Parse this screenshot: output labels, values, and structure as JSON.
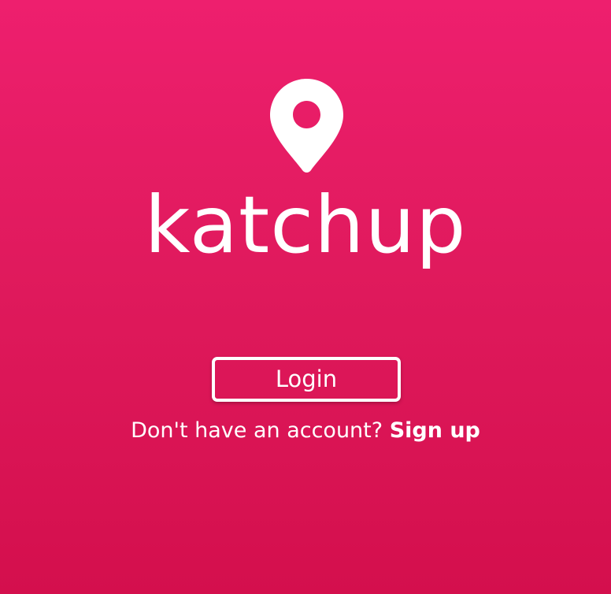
{
  "theme": {
    "background_top": "#ee1f6e",
    "background_bottom": "#d40f4d",
    "foreground": "#ffffff"
  },
  "logo": {
    "icon": "map-pin-icon",
    "brand_name": "katchup"
  },
  "login": {
    "button_label": "Login"
  },
  "signup": {
    "prompt_text": "Don't have an account?",
    "link_label": "Sign up"
  }
}
